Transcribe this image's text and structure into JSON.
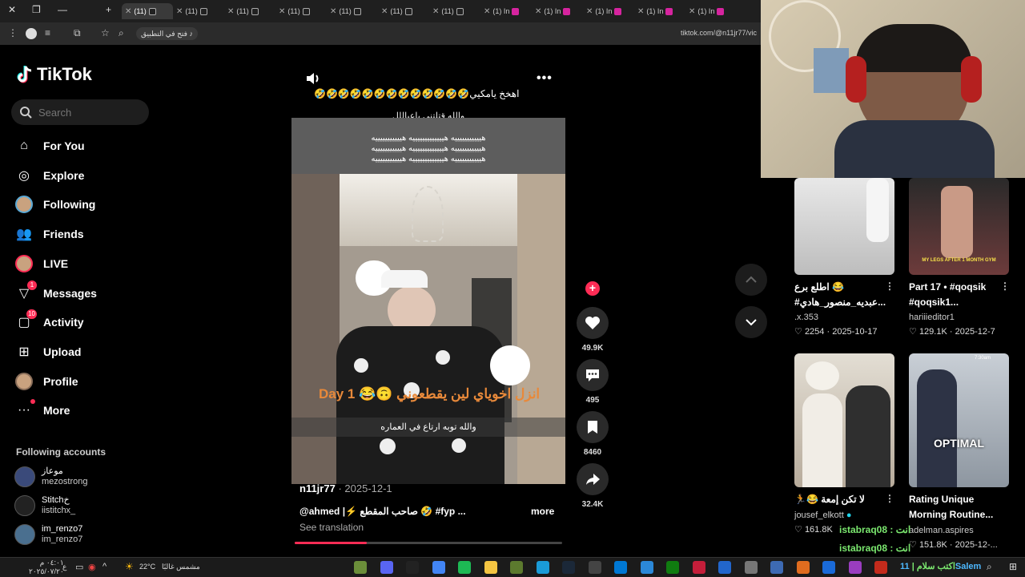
{
  "browser": {
    "tabs": [
      {
        "label": "(11)"
      },
      {
        "label": "(11)"
      },
      {
        "label": "(11)"
      },
      {
        "label": "(11)"
      },
      {
        "label": "(11)"
      },
      {
        "label": "(11)"
      },
      {
        "label": "(11)"
      },
      {
        "label": "(1) In"
      },
      {
        "label": "(1) In"
      },
      {
        "label": "(1) In"
      },
      {
        "label": "(1) In"
      },
      {
        "label": "(1) In"
      }
    ],
    "open_in_app": "فتح في التطبيق",
    "url": "tiktok.com/@n11jr77/vic"
  },
  "sidebar": {
    "logo": "TikTok",
    "search_placeholder": "Search",
    "nav": [
      {
        "label": "For You",
        "icon": "home-icon"
      },
      {
        "label": "Explore",
        "icon": "compass-icon"
      },
      {
        "label": "Following",
        "icon": "avatar-icon"
      },
      {
        "label": "Friends",
        "icon": "friends-icon"
      },
      {
        "label": "LIVE",
        "icon": "live-icon"
      },
      {
        "label": "Messages",
        "icon": "messages-icon",
        "badge": "1"
      },
      {
        "label": "Activity",
        "icon": "activity-icon",
        "badge": "10"
      },
      {
        "label": "Upload",
        "icon": "upload-icon"
      },
      {
        "label": "Profile",
        "icon": "profile-icon"
      },
      {
        "label": "More",
        "icon": "more-icon"
      }
    ],
    "following_title": "Following accounts",
    "accounts": [
      {
        "name": "موعاز",
        "handle": "mezostrong"
      },
      {
        "name": "Stitchخ",
        "handle": "iistitchx_"
      },
      {
        "name": "im_renzo7",
        "handle": "im_renzo7"
      }
    ]
  },
  "video": {
    "caption_top": "🤣🤣🤣🤣🤣🤣🤣🤣🤣🤣🤣🤣🤣اهخخ يامكيي",
    "caption_sub": "والله قتلتني ياعياللل",
    "haha_lines": [
      "هيييييييييييه هيييييييييييييه هيييييييييييه",
      "هيييييييييييه هيييييييييييييه هيييييييييييه",
      "هيييييييييييه هيييييييييييييه هيييييييييييه"
    ],
    "overlay_day": "Day 1 😂🙃 انزل اخوياي لين يقطعوني",
    "overlay_bottom": "والله توبه ارتاع في العماره",
    "author": "n11jr77",
    "date": "· 2025-12-1",
    "description": "@ahmed |⚡ صاحب المقطع 🤣 #fyp ...",
    "more": "more",
    "see_translation": "See translation",
    "progress": 0.27
  },
  "actions": {
    "likes": "49.9K",
    "comments": "495",
    "saves": "8460",
    "shares": "32.4K"
  },
  "cards": [
    {
      "title1": "😂 اطلع برع",
      "title2": "#عبديه_منصور_هادي...",
      "user": ".x.353",
      "likes": "2254",
      "date": "2025-10-17"
    },
    {
      "title1": "Part 17 • #qoqsik",
      "title2": "#qoqsik1...",
      "user": "hariiieditor1",
      "likes": "129.1K",
      "date": "2025-12-7",
      "thumb_text": "MY LEGS AFTER 1 MONTH GYM"
    },
    {
      "title1": "لا تكن إمعة 😂🏃",
      "user": "jousef_elkott",
      "likes": "161.8K"
    },
    {
      "title1": "Rating Unique",
      "title2": "Morning Routine...",
      "user": "adelman.aspires",
      "likes": "151.8K",
      "date": "2025-12-...",
      "thumb_text": "OPTIMAL",
      "thumb_time": "7:30am"
    }
  ],
  "chat": {
    "line1": "انت : istabraq08",
    "line2": "انت : istabraq08",
    "line3": "11Salem",
    "line4": "اكتب سلام"
  },
  "taskbar": {
    "weather": "22°C",
    "weather_text": "مشمس غالبًا",
    "time": "٠٤:٠١ م",
    "date": "٢٠٢٥/٠٧/٢٠"
  },
  "colors": {
    "accent": "#fe2c55",
    "chat": "#7be86f"
  }
}
